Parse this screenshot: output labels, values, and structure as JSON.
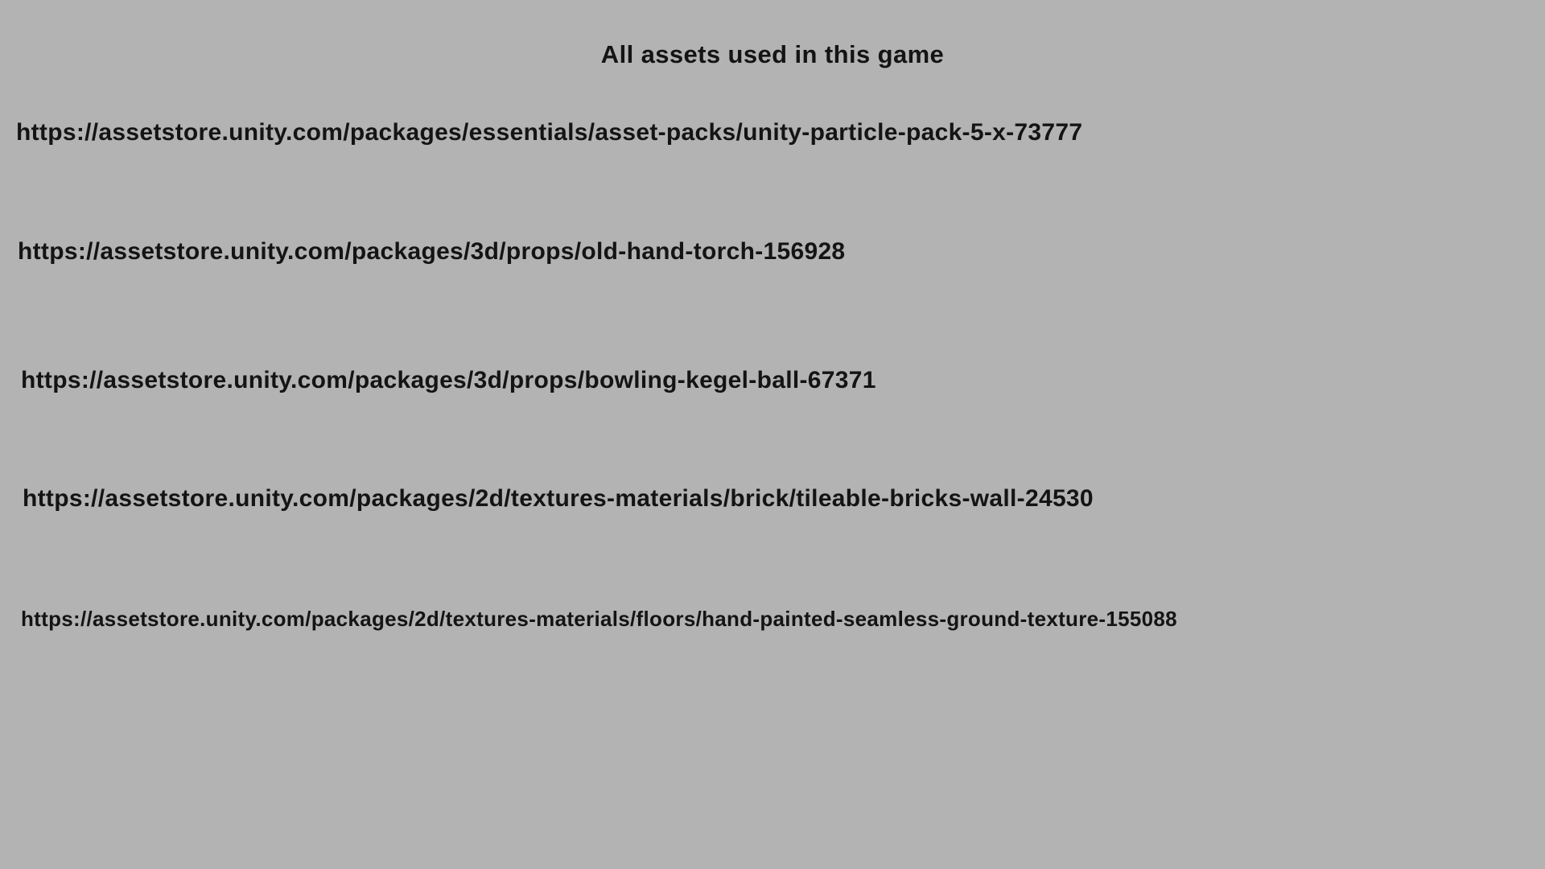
{
  "screen": {
    "title": "All assets used in this game",
    "credits": [
      "https://assetstore.unity.com/packages/essentials/asset-packs/unity-particle-pack-5-x-73777",
      "https://assetstore.unity.com/packages/3d/props/old-hand-torch-156928",
      "https://assetstore.unity.com/packages/3d/props/bowling-kegel-ball-67371",
      "https://assetstore.unity.com/packages/2d/textures-materials/brick/tileable-bricks-wall-24530",
      "https://assetstore.unity.com/packages/2d/textures-materials/floors/hand-painted-seamless-ground-texture-155088"
    ]
  },
  "colors": {
    "background": "#b3b3b3",
    "text": "#141414"
  }
}
